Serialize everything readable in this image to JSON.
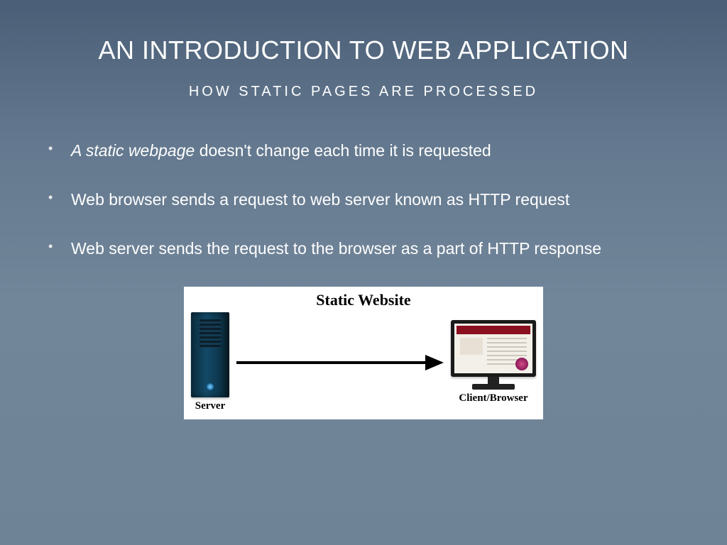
{
  "title": "AN INTRODUCTION TO WEB APPLICATION",
  "subtitle": "HOW STATIC PAGES ARE PROCESSED",
  "bullets": [
    {
      "italic_lead": "A static webpage",
      "rest": " doesn't change each time it is requested"
    },
    {
      "italic_lead": "",
      "rest": "Web browser sends a request to web server known as HTTP request"
    },
    {
      "italic_lead": "",
      "rest": "Web server sends the request to the browser as a part of HTTP response"
    }
  ],
  "diagram": {
    "title": "Static Website",
    "server_label": "Server",
    "client_label": "Client/Browser"
  }
}
